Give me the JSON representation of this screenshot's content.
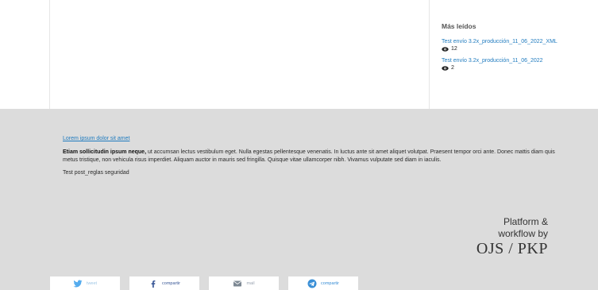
{
  "sidebar": {
    "title": "Más leídos",
    "items": [
      {
        "label": "Test envío 3.2x_producción_11_06_2022_XML",
        "views": "12"
      },
      {
        "label": "Test envío 3.2x_producción_11_06_2022",
        "views": "2"
      }
    ]
  },
  "footer": {
    "link": "Lorem ipsum dolor sit amet",
    "para_bold": "Etiam sollicitudin ipsum neque,",
    "para_rest": " ut accumsan lectus vestibulum eget. Nulla egestas pellentesque venenatis. In luctus ante sit amet aliquet volutpat. Praesent tempor orci ante. Donec mattis diam quis metus tristique, non vehicula risus imperdiet. Aliquam auctor in mauris sed fringilla. Quisque vitae ullamcorper nibh. Vivamus vulputate sed diam in iaculis.",
    "test_text": "Test post_reglas seguridad",
    "brand_line1": "Platform &",
    "brand_line2": "workflow by",
    "brand_logo": "OJS / PKP"
  },
  "share": {
    "tweet": "tweet",
    "facebook": "compartir",
    "mail": "mail",
    "telegram": "compartir"
  },
  "colors": {
    "link": "#1f7bbf",
    "footer_bg": "#dcdcdc",
    "twitter": "#55acee",
    "facebook": "#3b5998",
    "telegram": "#3a8fd6"
  }
}
